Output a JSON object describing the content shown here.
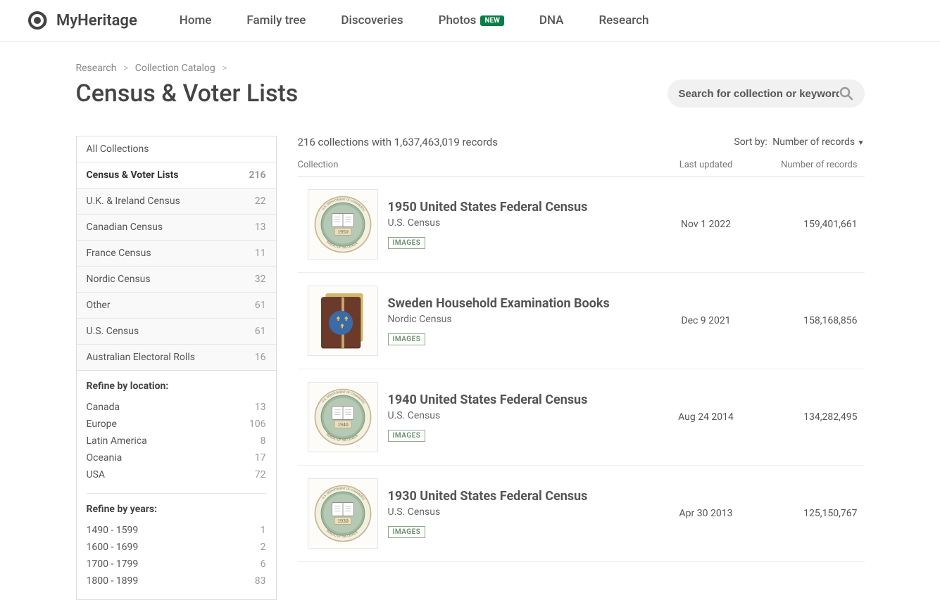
{
  "header": {
    "brand": "MyHeritage",
    "nav": [
      "Home",
      "Family tree",
      "Discoveries",
      "Photos",
      "DNA",
      "Research"
    ],
    "new_badge": "NEW"
  },
  "breadcrumb": {
    "research": "Research",
    "catalog": "Collection Catalog"
  },
  "page_title": "Census & Voter Lists",
  "search": {
    "placeholder": "Search for collection or keyword"
  },
  "sidebar": {
    "all_label": "All Collections",
    "categories": [
      {
        "label": "Census & Voter Lists",
        "count": "216",
        "active": true
      },
      {
        "label": "U.K. & Ireland Census",
        "count": "22"
      },
      {
        "label": "Canadian Census",
        "count": "13"
      },
      {
        "label": "France Census",
        "count": "11"
      },
      {
        "label": "Nordic Census",
        "count": "32"
      },
      {
        "label": "Other",
        "count": "61"
      },
      {
        "label": "U.S. Census",
        "count": "61"
      },
      {
        "label": "Australian Electoral Rolls",
        "count": "16"
      }
    ],
    "refine_location_title": "Refine by location:",
    "locations": [
      {
        "label": "Canada",
        "count": "13"
      },
      {
        "label": "Europe",
        "count": "106"
      },
      {
        "label": "Latin America",
        "count": "8"
      },
      {
        "label": "Oceania",
        "count": "17"
      },
      {
        "label": "USA",
        "count": "72"
      }
    ],
    "refine_years_title": "Refine by years:",
    "years": [
      {
        "label": "1490 - 1599",
        "count": "1"
      },
      {
        "label": "1600 - 1699",
        "count": "2"
      },
      {
        "label": "1700 - 1799",
        "count": "6"
      },
      {
        "label": "1800 - 1899",
        "count": "83"
      }
    ]
  },
  "summary": "216 collections with 1,637,463,019 records",
  "sort": {
    "label": "Sort by:",
    "value": "Number of records"
  },
  "columns": {
    "collection": "Collection",
    "updated": "Last updated",
    "records": "Number of records"
  },
  "images_tag": "IMAGES",
  "rows": [
    {
      "title": "1950 United States Federal Census",
      "sub": "U.S. Census",
      "updated": "Nov 1 2022",
      "records": "159,401,661",
      "thumb": "seal",
      "year": "1950"
    },
    {
      "title": "Sweden Household Examination Books",
      "sub": "Nordic Census",
      "updated": "Dec 9 2021",
      "records": "158,168,856",
      "thumb": "book"
    },
    {
      "title": "1940 United States Federal Census",
      "sub": "U.S. Census",
      "updated": "Aug 24 2014",
      "records": "134,282,495",
      "thumb": "seal",
      "year": "1940"
    },
    {
      "title": "1930 United States Federal Census",
      "sub": "U.S. Census",
      "updated": "Apr 30 2013",
      "records": "125,150,767",
      "thumb": "seal",
      "year": "1930"
    }
  ]
}
